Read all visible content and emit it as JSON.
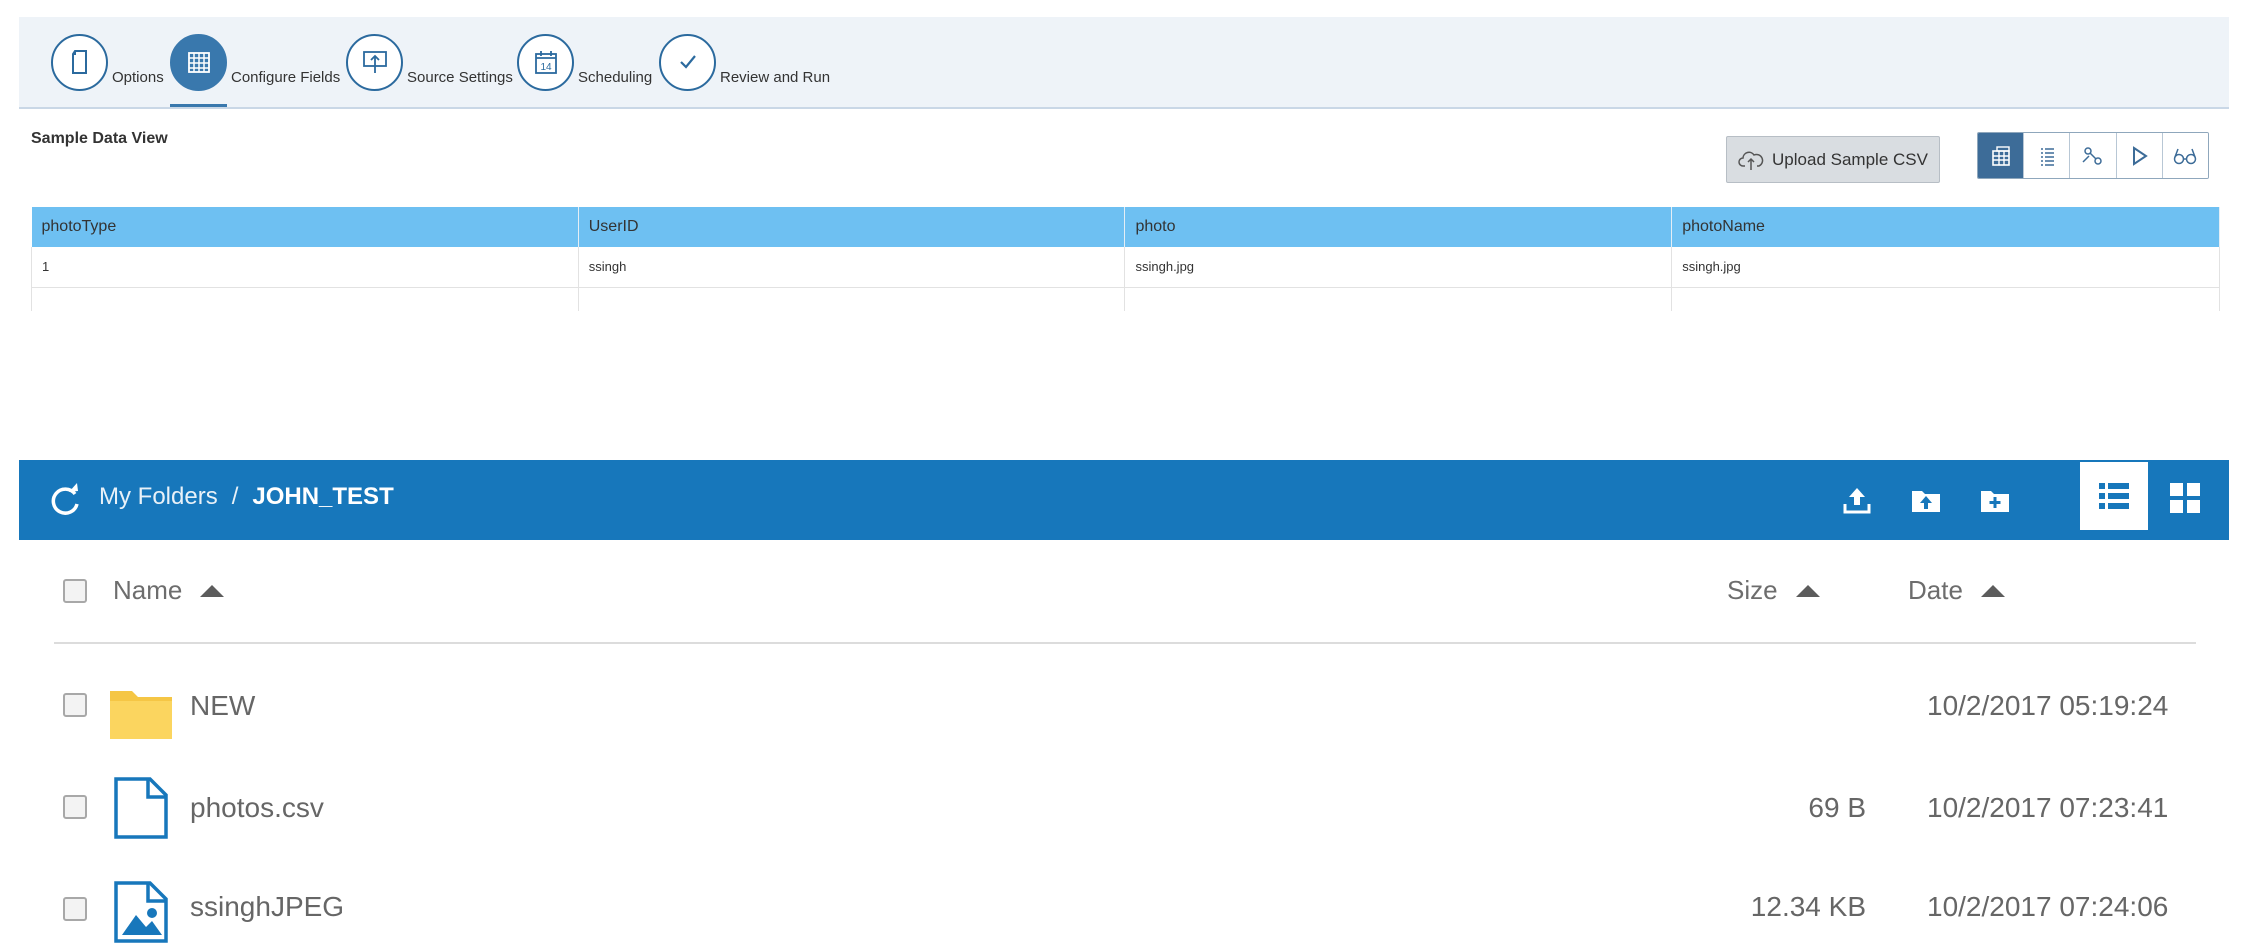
{
  "wizard": {
    "steps": [
      {
        "label": "Options",
        "icon": "document-icon",
        "active": false
      },
      {
        "label": "Configure Fields",
        "icon": "grid-icon",
        "active": true
      },
      {
        "label": "Source Settings",
        "icon": "presentation-upload-icon",
        "active": false
      },
      {
        "label": "Scheduling",
        "icon": "calendar-icon",
        "active": false,
        "calendar_day": "14"
      },
      {
        "label": "Review and Run",
        "icon": "checkmark-icon",
        "active": false
      }
    ]
  },
  "sample_data_view": {
    "title": "Sample Data View",
    "upload_button_label": "Upload Sample CSV",
    "toolbar_icons": [
      "table-view-icon",
      "list-view-icon",
      "mapping-icon",
      "run-icon",
      "preview-icon"
    ],
    "columns": [
      "photoType",
      "UserID",
      "photo",
      "photoName"
    ],
    "rows": [
      [
        "1",
        "ssingh",
        "ssingh.jpg",
        "ssingh.jpg"
      ]
    ]
  },
  "file_browser": {
    "breadcrumb_root": "My Folders",
    "breadcrumb_separator": "/",
    "breadcrumb_current": "JOHN_TEST",
    "columns": {
      "name": "Name",
      "size": "Size",
      "date": "Date"
    },
    "items": [
      {
        "name": "NEW",
        "type": "folder",
        "size": "",
        "date": "10/2/2017 05:19:24"
      },
      {
        "name": "photos.csv",
        "type": "file",
        "size": "69 B",
        "date": "10/2/2017 07:23:41"
      },
      {
        "name": "ssinghJPEG",
        "type": "image",
        "size": "12.34 KB",
        "date": "10/2/2017 07:24:06"
      }
    ]
  },
  "colors": {
    "wizard_bg": "#eef3f8",
    "step_accent": "#3978ad",
    "table_header": "#6ec0f2",
    "browser_header": "#1777bb",
    "folder_yellow": "#f9cf52",
    "file_blue": "#1777bb"
  }
}
